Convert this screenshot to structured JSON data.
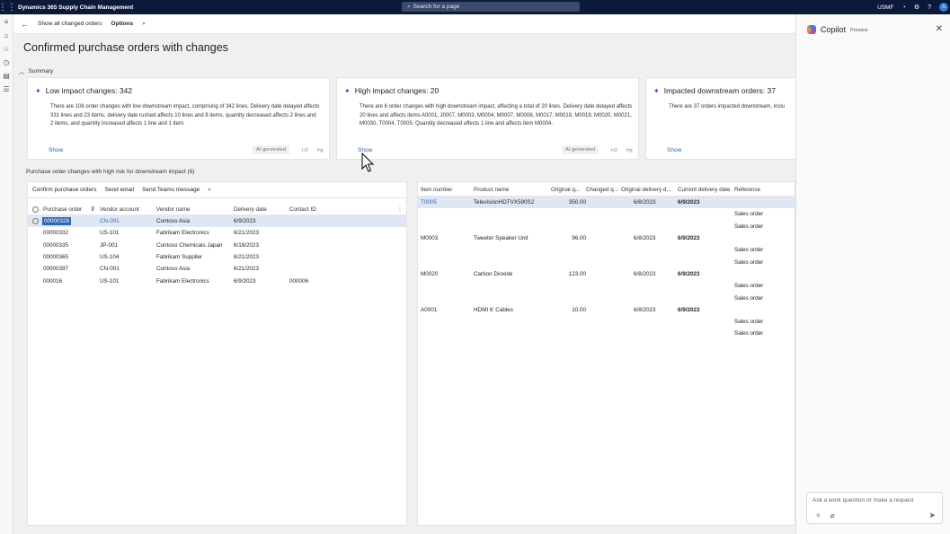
{
  "topbar": {
    "app_title": "Dynamics 365 Supply Chain Management",
    "search_placeholder": "Search for a page",
    "company": "USMF",
    "avatar_initial": "S"
  },
  "actionbar": {
    "show_all": "Show all changed orders",
    "options": "Options"
  },
  "page": {
    "title": "Confirmed purchase orders with changes",
    "summary_label": "Summary"
  },
  "cards": [
    {
      "title": "Low impact changes: 342",
      "body": "There are 108 order changes with low downstream impact, comprising of 342 lines. Delivery date delayed affects 331 lines and 23 items, delivery date rushed affects 10 lines and 8 items, quantity decreased affects 2 lines and 2 items, and quantity increased affects 1 line and 1 item.",
      "show": "Show",
      "badge": "AI generated"
    },
    {
      "title": "High impact changes: 20",
      "body": "There are 6 order changes with high downstream impact, affecting a total of 20 lines. Delivery date delayed affects 20 lines and affects items A0001, J0007, M0003, M0004, M0007, M0008, M0017, M0018, M0019, M0020, M0021, M0030, T0004, T0005. Quantity decreased affects 1 line and affects item M0004.",
      "show": "Show",
      "badge": "AI generated"
    },
    {
      "title": "Impacted downstream orders: 37",
      "body": "There are 37 orders impacted downstream, inclu",
      "show": "Show"
    }
  ],
  "section_title": "Purchase order changes with high risk for downstream impact (6)",
  "left_grid": {
    "toolbar": [
      "Confirm purchase orders",
      "Send email",
      "Send Teams message"
    ],
    "headers": [
      "Purchase order",
      "Vendor account",
      "Vendor name",
      "Delivery date",
      "Contact ID"
    ],
    "rows": [
      [
        "00000328",
        "CN-001",
        "Contoso Asia",
        "6/9/2023",
        ""
      ],
      [
        "00000332",
        "US-101",
        "Fabrikam Electronics",
        "6/21/2023",
        ""
      ],
      [
        "00000335",
        "JP-001",
        "Contoso Chemicals Japan",
        "6/18/2023",
        ""
      ],
      [
        "00000365",
        "US-104",
        "Fabrikam Supplier",
        "6/21/2023",
        ""
      ],
      [
        "00000397",
        "CN-001",
        "Contoso Asia",
        "6/21/2023",
        ""
      ],
      [
        "000016",
        "US-101",
        "Fabrikam Electronics",
        "6/9/2023",
        "000006"
      ]
    ]
  },
  "right_grid": {
    "headers": [
      "Item number",
      "Product name",
      "Original q...",
      "Changed q...",
      "Original delivery d...",
      "Current delivery date",
      "Reference"
    ],
    "rows": [
      [
        "T0005",
        "TelevisionHDTVX590S2",
        "350.00",
        "",
        "6/8/2023",
        "6/9/2023",
        ""
      ],
      [
        "",
        "",
        "",
        "",
        "",
        "",
        "Sales order"
      ],
      [
        "",
        "",
        "",
        "",
        "",
        "",
        "Sales order"
      ],
      [
        "M0003",
        "Tweeter Speaker Unit",
        "96.00",
        "",
        "6/8/2023",
        "6/9/2023",
        ""
      ],
      [
        "",
        "",
        "",
        "",
        "",
        "",
        "Sales order"
      ],
      [
        "",
        "",
        "",
        "",
        "",
        "",
        "Sales order"
      ],
      [
        "M0020",
        "Carbon Dioxide",
        "123.00",
        "",
        "6/8/2023",
        "6/9/2023",
        ""
      ],
      [
        "",
        "",
        "",
        "",
        "",
        "",
        "Sales order"
      ],
      [
        "",
        "",
        "",
        "",
        "",
        "",
        "Sales order"
      ],
      [
        "A0001",
        "HDMI 6' Cables",
        "10.00",
        "",
        "6/8/2023",
        "6/9/2023",
        ""
      ],
      [
        "",
        "",
        "",
        "",
        "",
        "",
        "Sales order"
      ],
      [
        "",
        "",
        "",
        "",
        "",
        "",
        "Sales order"
      ]
    ]
  },
  "copilot": {
    "title": "Copilot",
    "preview": "Preview",
    "input_placeholder": "Ask a work question or make a request"
  },
  "colors": {
    "topbar": "#0b1a3a",
    "link": "#2f66b3",
    "selection": "#dfe7f5",
    "spark": "#4b3bbf"
  }
}
